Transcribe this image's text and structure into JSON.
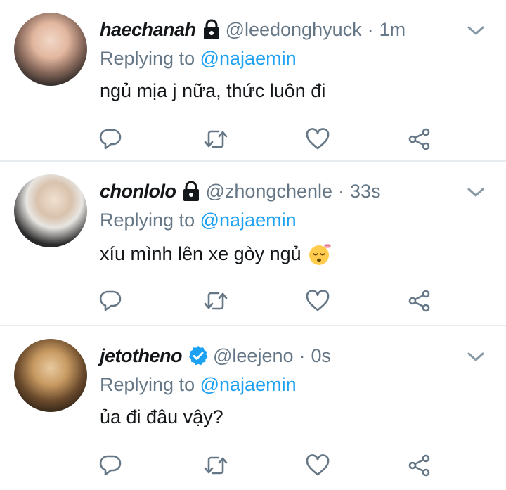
{
  "reply_prefix": "Replying to",
  "tweets": [
    {
      "display_name": "haechanah",
      "handle": "@leedonghyuck",
      "separator": "·",
      "time": "1m",
      "badge": "lock-icon",
      "replying_to": "@najaemin",
      "text": "ngủ mịa j nữa, thức luôn đi"
    },
    {
      "display_name": "chonlolo",
      "handle": "@zhongchenle",
      "separator": "·",
      "time": "33s",
      "badge": "lock-icon",
      "replying_to": "@najaemin",
      "text": "xíu mình lên xe gòy ngủ",
      "emoji": "sleeping-face-emoji"
    },
    {
      "display_name": "jetotheno",
      "handle": "@leejeno",
      "separator": "·",
      "time": "0s",
      "badge": "verified-badge-icon",
      "replying_to": "@najaemin",
      "text": "ủa đi đâu vậy?"
    }
  ],
  "actions": [
    "reply-icon",
    "retweet-icon",
    "like-icon",
    "share-icon"
  ],
  "colors": {
    "text": "#14171a",
    "secondary": "#657786",
    "accent": "#1da1f2",
    "divider": "#e6ecf0"
  }
}
